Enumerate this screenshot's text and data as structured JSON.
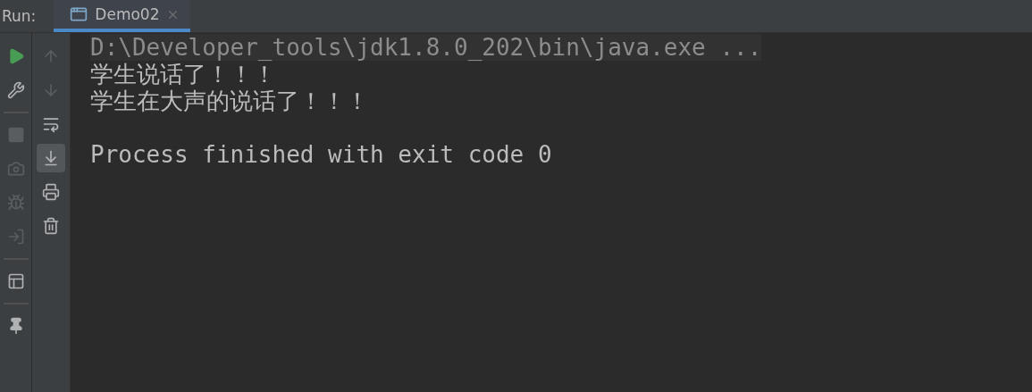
{
  "run_bar": {
    "label": "Run:",
    "tabs": [
      {
        "title": "Demo02",
        "selected": true
      }
    ]
  },
  "left_toolbar": [
    {
      "kind": "button",
      "disabled": false
    },
    {
      "kind": "button",
      "disabled": false
    },
    {
      "kind": "divider"
    },
    {
      "kind": "button",
      "disabled": true
    },
    {
      "kind": "button",
      "disabled": true
    },
    {
      "kind": "button",
      "disabled": true
    },
    {
      "kind": "button",
      "disabled": true
    },
    {
      "kind": "divider"
    },
    {
      "kind": "button",
      "disabled": false
    },
    {
      "kind": "divider"
    },
    {
      "kind": "button",
      "disabled": false
    }
  ],
  "console_toolbar": [
    {
      "disabled": true,
      "selected": false
    },
    {
      "disabled": true,
      "selected": false
    },
    {
      "disabled": false,
      "selected": false
    },
    {
      "disabled": false,
      "selected": true
    },
    {
      "disabled": false,
      "selected": false
    },
    {
      "disabled": false,
      "selected": false
    }
  ],
  "console": [
    {
      "kind": "command",
      "text": "D:\\Developer_tools\\jdk1.8.0_202\\bin\\java.exe ..."
    },
    {
      "kind": "output",
      "text": "学生说话了！！！"
    },
    {
      "kind": "output",
      "text": "学生在大声的说话了！！！"
    },
    {
      "kind": "blank"
    },
    {
      "kind": "output",
      "text": "Process finished with exit code 0"
    }
  ]
}
